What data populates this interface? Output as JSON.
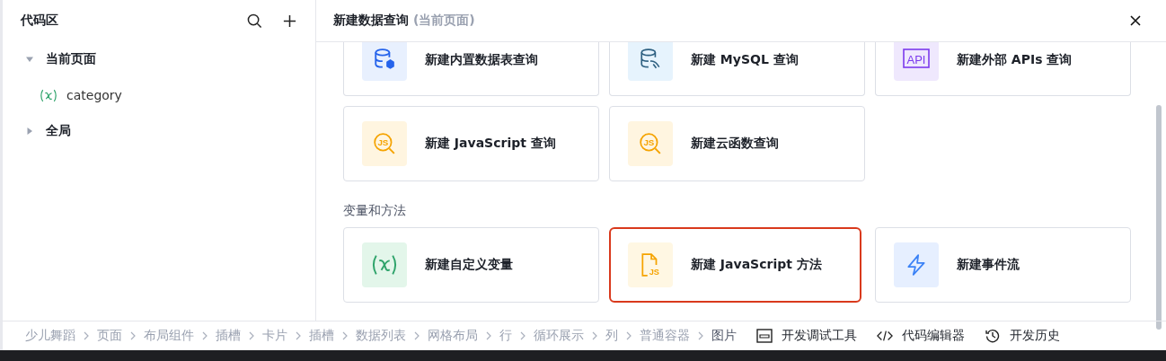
{
  "sidebar": {
    "title": "代码区",
    "tree": [
      {
        "label": "当前页面",
        "expanded": true,
        "children": [
          {
            "label": "category",
            "kind": "variable"
          }
        ]
      },
      {
        "label": "全局",
        "expanded": false
      }
    ]
  },
  "panel": {
    "title": "新建数据查询",
    "subtitle": "(当前页面)",
    "sections": [
      {
        "cards": [
          {
            "label": "新建内置数据表查询",
            "kind": "database",
            "selected": false
          },
          {
            "label": "新建 MySQL 查询",
            "kind": "mysql",
            "selected": false
          },
          {
            "label": "新建外部 APIs 查询",
            "kind": "api",
            "glyph": "API",
            "selected": false
          },
          {
            "label": "新建 JavaScript 查询",
            "kind": "js-query",
            "glyph": "JS",
            "selected": false
          },
          {
            "label": "新建云函数查询",
            "kind": "js-query",
            "glyph": "JS",
            "selected": false
          }
        ]
      },
      {
        "title": "变量和方法",
        "cards": [
          {
            "label": "新建自定义变量",
            "kind": "variable",
            "selected": false
          },
          {
            "label": "新建 JavaScript 方法",
            "kind": "js-file",
            "glyph": "JS",
            "selected": true
          },
          {
            "label": "新建事件流",
            "kind": "flow",
            "selected": false
          }
        ]
      }
    ]
  },
  "breadcrumb": [
    {
      "label": "少儿舞蹈",
      "selected": false
    },
    {
      "label": "页面",
      "selected": false
    },
    {
      "label": "布局组件",
      "selected": false
    },
    {
      "label": "插槽",
      "selected": false
    },
    {
      "label": "卡片",
      "selected": false
    },
    {
      "label": "插槽",
      "selected": false
    },
    {
      "label": "数据列表",
      "selected": false
    },
    {
      "label": "网格布局",
      "selected": false
    },
    {
      "label": "行",
      "selected": false
    },
    {
      "label": "循环展示",
      "selected": false
    },
    {
      "label": "列",
      "selected": false
    },
    {
      "label": "普通容器",
      "selected": false
    },
    {
      "label": "图片",
      "selected": true
    }
  ],
  "tools": [
    {
      "label": "开发调试工具",
      "kind": "debug"
    },
    {
      "label": "代码编辑器",
      "kind": "code"
    },
    {
      "label": "开发历史",
      "kind": "history"
    }
  ]
}
